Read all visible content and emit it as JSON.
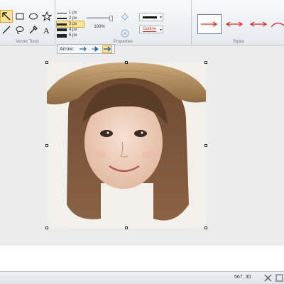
{
  "ribbon": {
    "groups": {
      "vector_tools": "Vector Tools",
      "properties": "Properties",
      "styles": "Styles"
    },
    "tools": [
      {
        "name": "select-arrow-tool",
        "icon": "select-arrow-icon",
        "active": true
      },
      {
        "name": "rectangle-tool",
        "icon": "rectangle-icon",
        "active": false
      },
      {
        "name": "ellipse-tool",
        "icon": "ellipse-icon",
        "active": false
      },
      {
        "name": "star-tool",
        "icon": "star-icon",
        "active": false
      },
      {
        "name": "line-tool",
        "icon": "line-icon",
        "active": false
      },
      {
        "name": "lasso-tool",
        "icon": "lasso-icon",
        "active": false
      },
      {
        "name": "eyedropper-tool",
        "icon": "eyedropper-icon",
        "active": false
      },
      {
        "name": "text-tool",
        "icon": "text-icon",
        "active": false
      }
    ],
    "line_widths": [
      {
        "label": "1 px",
        "selected": false
      },
      {
        "label": "2 px",
        "selected": false
      },
      {
        "label": "3 px",
        "selected": true
      },
      {
        "label": "4 px",
        "selected": false
      },
      {
        "label": "5 px",
        "selected": false
      }
    ],
    "opacity": {
      "value": "100%",
      "level": 1.0
    },
    "stroke_style": {
      "icon": "solid-line-icon"
    },
    "outline": {
      "label": "Outline"
    }
  },
  "arrow_toolbar": {
    "label": "Arrow:",
    "options": [
      {
        "name": "arrow-style-1",
        "active": false
      },
      {
        "name": "arrow-style-2",
        "active": false
      },
      {
        "name": "arrow-style-3",
        "active": true
      }
    ]
  },
  "canvas": {
    "image": {
      "description_icon": "photo-image"
    }
  },
  "status_bar": {
    "coordinates": "567, 30"
  },
  "colors": {
    "accent_highlight": "#fbe39a",
    "arrow_red": "#d62b2b",
    "arrow_blue": "#2b6ea3"
  }
}
